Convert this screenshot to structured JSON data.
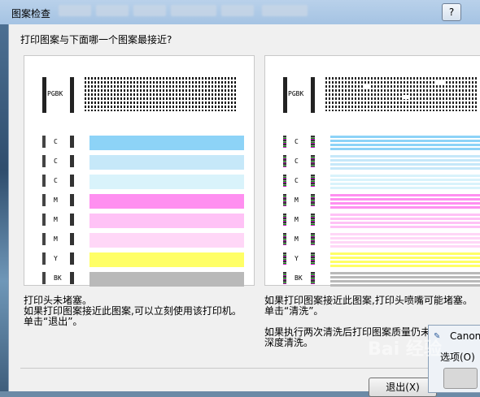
{
  "window": {
    "title": "图案检查",
    "help_label": "?"
  },
  "question": "打印图案与下面哪一个图案最接近?",
  "left_panel": {
    "pgbk_label": "PGBK",
    "rows": [
      {
        "label": "C",
        "color": "#8dd3f7"
      },
      {
        "label": "C",
        "color": "#c6e8f9"
      },
      {
        "label": "C",
        "color": "#d9f3fb"
      },
      {
        "label": "M",
        "color": "#ff8ff0"
      },
      {
        "label": "M",
        "color": "#ffc2f6"
      },
      {
        "label": "M",
        "color": "#ffd7f7"
      },
      {
        "label": "Y",
        "color": "#ffff66"
      },
      {
        "label": "BK",
        "color": "#b9b9b9"
      }
    ],
    "text_lines": [
      "打印头未堵塞。",
      "如果打印图案接近此图案,可以立刻使用该打印机。",
      "单击“退出”。"
    ]
  },
  "right_panel": {
    "pgbk_label": "PGBK",
    "rows": [
      {
        "label": "C",
        "color": "#8dd3f7"
      },
      {
        "label": "C",
        "color": "#c6e8f9"
      },
      {
        "label": "C",
        "color": "#d9f3fb"
      },
      {
        "label": "M",
        "color": "#ff8ff0"
      },
      {
        "label": "M",
        "color": "#ffc2f6"
      },
      {
        "label": "M",
        "color": "#ffd7f7"
      },
      {
        "label": "Y",
        "color": "#ffff66"
      },
      {
        "label": "BK",
        "color": "#b9b9b9"
      }
    ],
    "text_lines": [
      "如果打印图案接近此图案,打印头喷嘴可能堵塞。",
      "单击“清洗”。",
      "",
      "如果执行两次清洗后打印图案质量仍未",
      "深度清洗。"
    ]
  },
  "exit_button": "退出(X)",
  "side_popup": {
    "item1": "Canon",
    "item2": "选项(O)"
  },
  "watermark": "Bai 经验"
}
